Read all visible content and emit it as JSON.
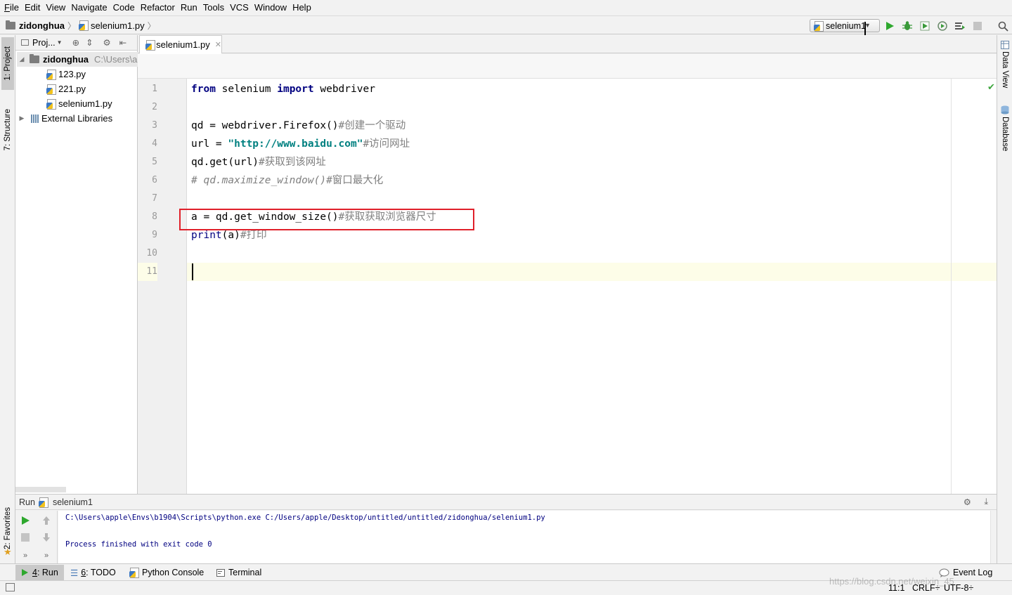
{
  "menu": [
    "File",
    "Edit",
    "View",
    "Navigate",
    "Code",
    "Refactor",
    "Run",
    "Tools",
    "VCS",
    "Window",
    "Help"
  ],
  "menu_mnemonics": [
    "F",
    "E",
    "V",
    "N",
    "C",
    "R",
    "R",
    "T",
    "S",
    "W",
    "H"
  ],
  "nav": {
    "project": "zidonghua",
    "file": "selenium1.py",
    "run_config": "selenium1"
  },
  "left_strip": {
    "project_tab": "1: Project",
    "structure_tab": "7: Structure",
    "favorites_tab": "2: Favorites"
  },
  "right_strip": {
    "data_view_tab": "Data View",
    "database_tab": "Database"
  },
  "project_panel": {
    "header": "Proj...",
    "root_name": "zidonghua",
    "root_path": "C:\\Users\\a",
    "files": [
      "123.py",
      "221.py",
      "selenium1.py"
    ],
    "external": "External Libraries"
  },
  "editor": {
    "tab_label": "selenium1.py",
    "line_numbers": [
      "1",
      "2",
      "3",
      "4",
      "5",
      "6",
      "7",
      "8",
      "9",
      "10",
      "11"
    ],
    "lines": {
      "l1": {
        "kw1": "from",
        "t1": " selenium ",
        "kw2": "import",
        "t2": " webdriver"
      },
      "l3": {
        "code": "qd = webdriver.Firefox()",
        "comment": "#创建一个驱动"
      },
      "l4": {
        "code": "url = ",
        "string": "\"http://www.baidu.com\"",
        "comment": "#访问网址"
      },
      "l5": {
        "code": "qd.get(url)",
        "comment": "#获取到该网址"
      },
      "l6": {
        "comment": "# qd.maximize_window()",
        "comment2": "#窗口最大化"
      },
      "l8": {
        "code": "a = qd.get_window_size()",
        "comment": "#获取获取浏览器尺寸"
      },
      "l9": {
        "builtin": "print",
        "code": "(a)",
        "comment": "#打印"
      }
    },
    "highlighted_line": "8",
    "current_line": "11"
  },
  "run_panel": {
    "label": "Run",
    "config": "selenium1",
    "command": "C:\\Users\\apple\\Envs\\b1904\\Scripts\\python.exe C:/Users/apple/Desktop/untitled/untitled/zidonghua/selenium1.py",
    "exit_message": "Process finished with exit code 0"
  },
  "bottom_tabs": {
    "run_num": "4",
    "run_label": ": Run",
    "todo_num": "6",
    "todo_label": ": TODO",
    "python_console": "Python Console",
    "terminal": "Terminal",
    "event_log": "Event Log"
  },
  "status": {
    "position": "11:1",
    "line_sep": "CRLF÷",
    "encoding": "UTF-8÷"
  },
  "watermark": "https://blog.csdn.net/weixin_45"
}
